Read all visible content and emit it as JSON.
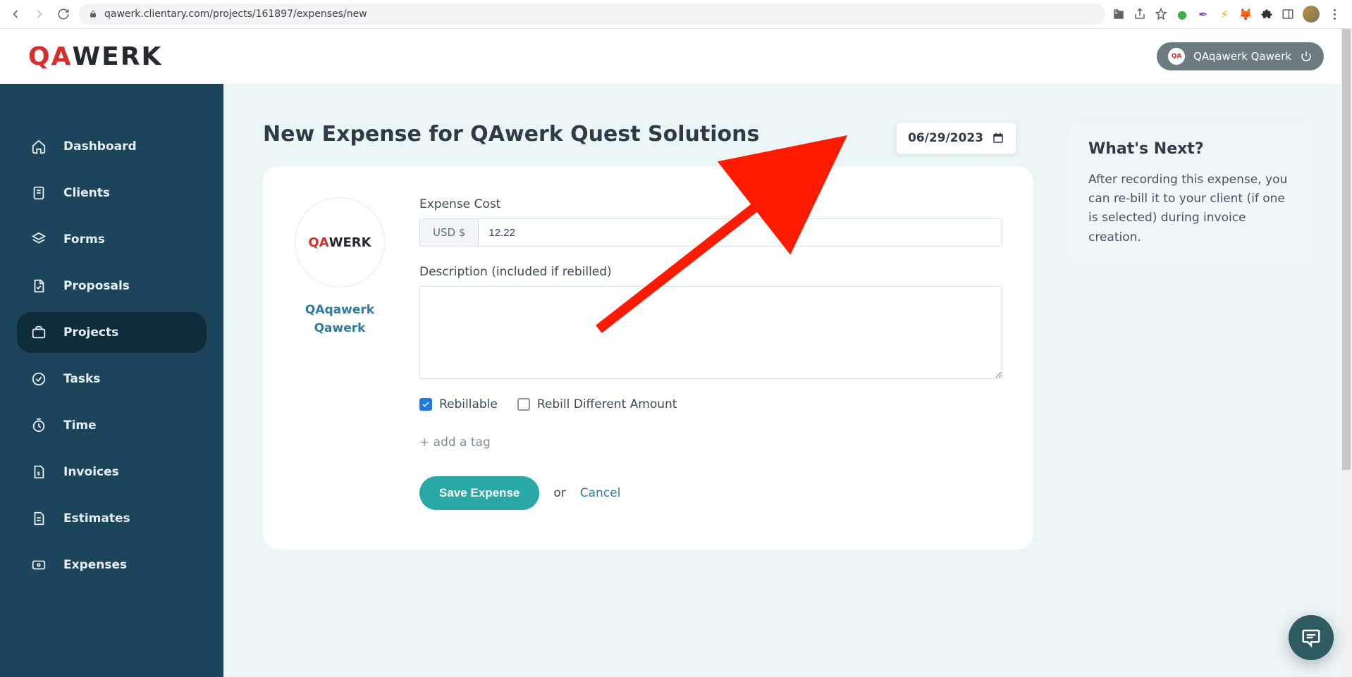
{
  "browser": {
    "url": "qawerk.clientary.com/projects/161897/expenses/new"
  },
  "header": {
    "logo_qa": "QA",
    "logo_werk": "WERK",
    "user_name": "QAqawerk Qawerk"
  },
  "sidebar": {
    "items": [
      {
        "label": "Dashboard",
        "active": false,
        "icon": "home-icon"
      },
      {
        "label": "Clients",
        "active": false,
        "icon": "clients-icon"
      },
      {
        "label": "Forms",
        "active": false,
        "icon": "forms-icon"
      },
      {
        "label": "Proposals",
        "active": false,
        "icon": "proposals-icon"
      },
      {
        "label": "Projects",
        "active": true,
        "icon": "projects-icon"
      },
      {
        "label": "Tasks",
        "active": false,
        "icon": "tasks-icon"
      },
      {
        "label": "Time",
        "active": false,
        "icon": "time-icon"
      },
      {
        "label": "Invoices",
        "active": false,
        "icon": "invoices-icon"
      },
      {
        "label": "Estimates",
        "active": false,
        "icon": "estimates-icon"
      },
      {
        "label": "Expenses",
        "active": false,
        "icon": "expenses-icon"
      }
    ]
  },
  "page": {
    "title": "New Expense for QAwerk Quest Solutions",
    "date": "06/29/2023",
    "profile_name": "QAqawerk Qawerk",
    "profile_logo_qa": "QA",
    "profile_logo_werk": "WERK",
    "expense_cost_label": "Expense Cost",
    "currency_prefix": "USD $",
    "amount_value": "12.22",
    "description_label": "Description (included if rebilled)",
    "description_value": "",
    "rebillable_label": "Rebillable",
    "rebillable_checked": true,
    "rebill_diff_label": "Rebill Different Amount",
    "rebill_diff_checked": false,
    "add_tag_label": "+ add a tag",
    "save_label": "Save Expense",
    "or_label": "or",
    "cancel_label": "Cancel"
  },
  "info": {
    "title": "What's Next?",
    "text": "After recording this expense, you can re-bill it to your client (if one is selected) during invoice creation."
  }
}
